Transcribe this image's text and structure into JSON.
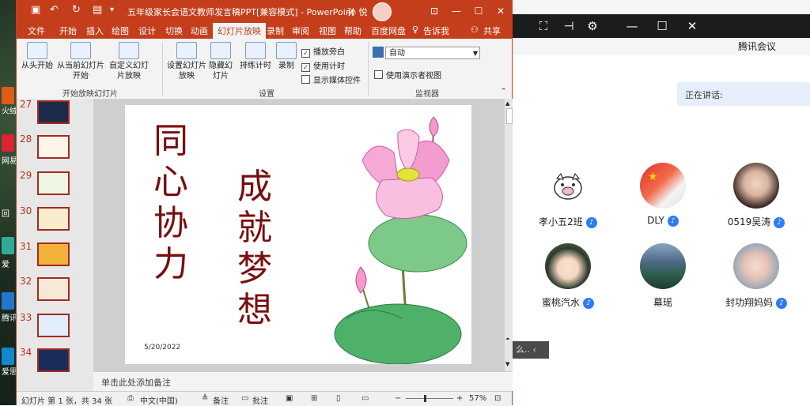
{
  "desktop": {
    "labels": [
      "火绒",
      "网易",
      "回",
      "爱",
      "腾讯",
      "爱思"
    ]
  },
  "meeting": {
    "title": "腾讯会议",
    "speaking_label": "正在讲话:",
    "participants": [
      {
        "name": "孝小五2班"
      },
      {
        "name": "DLY"
      },
      {
        "name": "0519吴涛"
      },
      {
        "name": "蜜桃汽水"
      },
      {
        "name": "幕瑶"
      },
      {
        "name": "封功翔妈妈"
      }
    ],
    "float_text": "么..",
    "colors": {
      "accent": "#2d7cf2"
    }
  },
  "ppt": {
    "title": "五年级家长会语文教师发言稿PPT[兼容模式] - PowerPoint",
    "user": "孙 悦",
    "menu": [
      "文件",
      "开始",
      "插入",
      "绘图",
      "设计",
      "切换",
      "动画",
      "幻灯片放映",
      "录制",
      "审阅",
      "视图",
      "帮助",
      "百度网盘",
      "告诉我",
      "共享"
    ],
    "active_menu": "幻灯片放映",
    "ribbon": {
      "from_start": "从头开始",
      "from_current": "从当前幻灯片开始",
      "custom_show": "自定义幻灯片放映",
      "group1": "开始放映幻灯片",
      "setup_show": "设置幻灯片放映",
      "hide_slide": "隐藏幻灯片",
      "rehearse": "排练计时",
      "record": "录制",
      "play_narration": "播放旁白",
      "use_timings": "使用计时",
      "show_media": "显示媒体控件",
      "group2": "设置",
      "monitor_value": "自动",
      "presenter_view": "使用演示者视图",
      "group3": "监视器"
    },
    "thumbnails": [
      "27",
      "28",
      "29",
      "30",
      "31",
      "32",
      "33",
      "34"
    ],
    "slide": {
      "col1": [
        "同",
        "心",
        "协",
        "力"
      ],
      "col2": [
        "成",
        "就",
        "梦",
        "想"
      ],
      "date": "5/20/2022"
    },
    "notes_placeholder": "单击此处添加备注",
    "status": {
      "slide_info": "幻灯片 第 1 张，共 34 张",
      "language": "中文(中国)",
      "notes": "备注",
      "comments": "批注",
      "zoom": "57%"
    },
    "colors": {
      "brand": "#c43e1c",
      "slide_text": "#7a0e0e"
    }
  }
}
